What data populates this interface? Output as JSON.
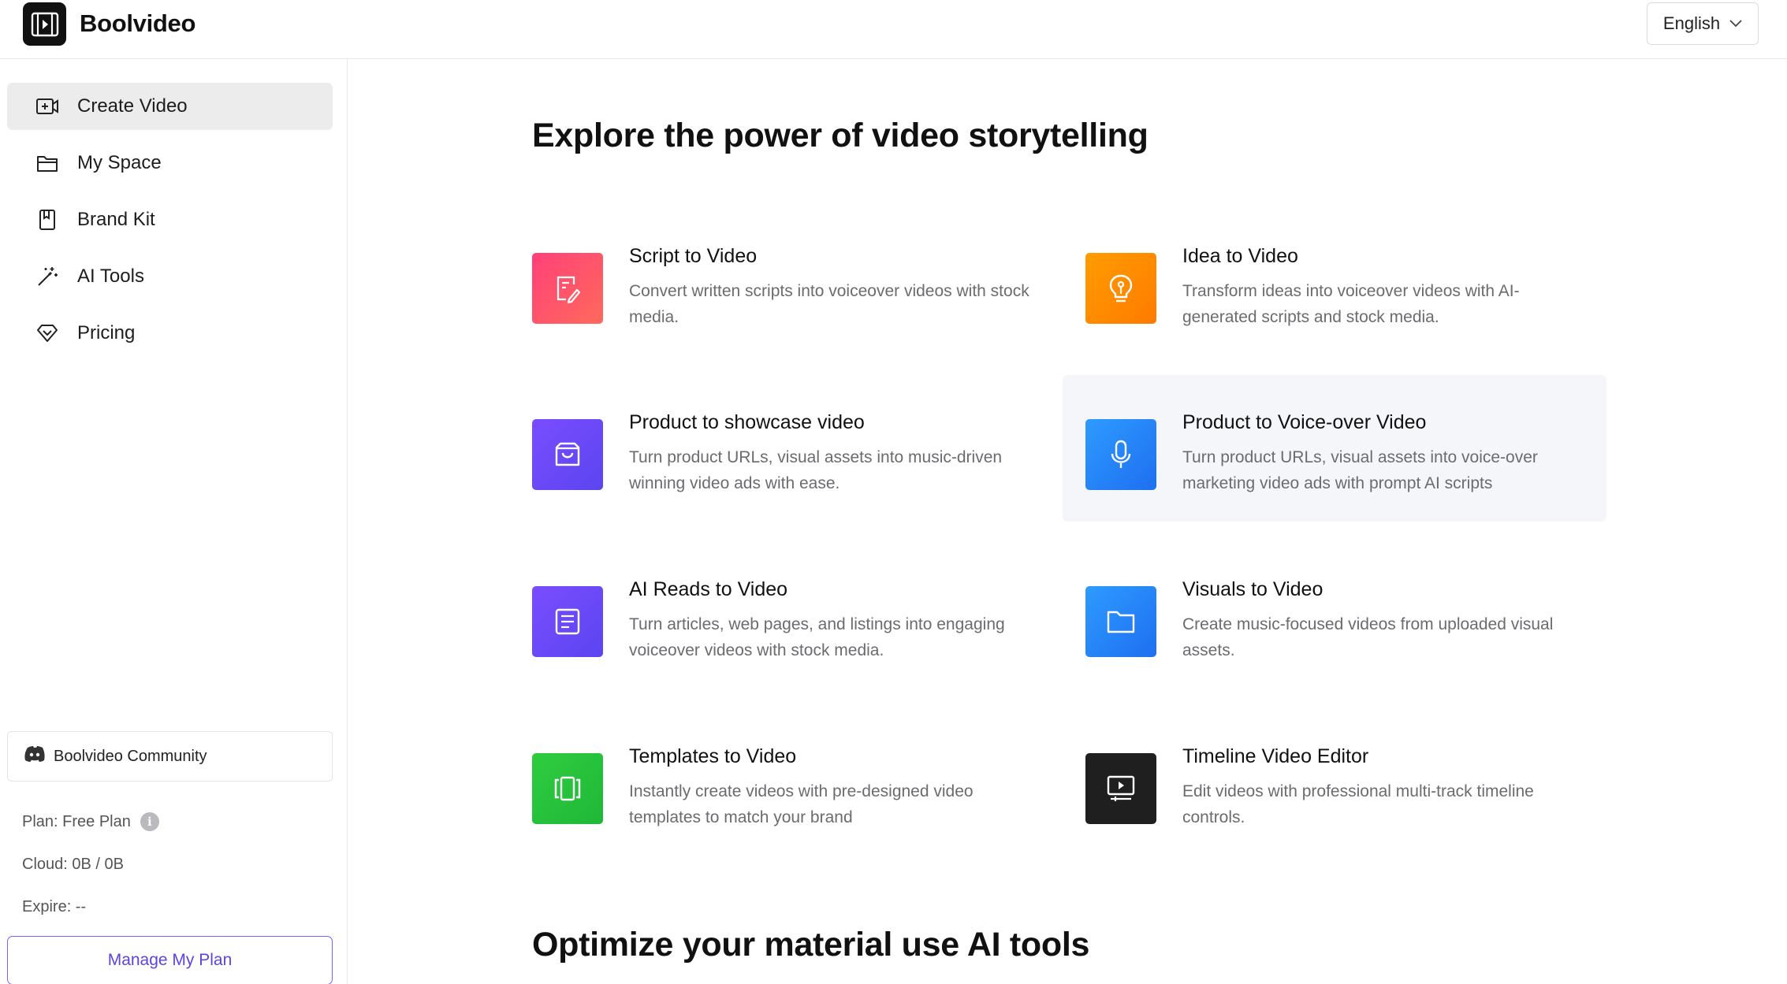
{
  "app": {
    "brand": "Boolvideo"
  },
  "header": {
    "language": "English"
  },
  "sidebar": {
    "items": [
      {
        "label": "Create Video",
        "icon": "video-plus-icon",
        "active": true
      },
      {
        "label": "My Space",
        "icon": "folder-icon",
        "active": false
      },
      {
        "label": "Brand Kit",
        "icon": "bookmark-icon",
        "active": false
      },
      {
        "label": "AI Tools",
        "icon": "magic-wand-icon",
        "active": false
      },
      {
        "label": "Pricing",
        "icon": "diamond-icon",
        "active": false
      }
    ],
    "community": "Boolvideo Community",
    "plan": "Plan: Free Plan",
    "cloud": "Cloud: 0B / 0B",
    "expire": "Expire: --",
    "manage_button": "Manage My Plan"
  },
  "main": {
    "title": "Explore the power of video storytelling",
    "section2_title": "Optimize your material use AI tools",
    "cards": [
      {
        "title": "Script to Video",
        "desc": "Convert written scripts into voiceover videos with stock media.",
        "icon": "script-edit-icon",
        "color": "#ff4f6e"
      },
      {
        "title": "Idea to Video",
        "desc": "Transform ideas into voiceover videos with AI-generated scripts and stock media.",
        "icon": "lightbulb-icon",
        "color": "#ff8a00"
      },
      {
        "title": "Product to showcase video",
        "desc": "Turn product URLs, visual assets into music-driven winning video ads with ease.",
        "icon": "shopping-bag-icon",
        "color": "#6e4cf5"
      },
      {
        "title": "Product to Voice-over Video",
        "desc": "Turn product URLs, visual assets into voice-over marketing video ads with prompt AI scripts",
        "icon": "microphone-icon",
        "color": "#1e88f5"
      },
      {
        "title": "AI Reads to Video",
        "desc": "Turn articles, web pages, and listings into engaging voiceover videos with stock media.",
        "icon": "article-icon",
        "color": "#6e4cf5"
      },
      {
        "title": "Visuals to Video",
        "desc": "Create music-focused videos from uploaded visual assets.",
        "icon": "folder-icon",
        "color": "#1e88f5"
      },
      {
        "title": "Templates to Video",
        "desc": "Instantly create videos with pre-designed video templates to match your brand",
        "icon": "templates-icon",
        "color": "#24c23c"
      },
      {
        "title": "Timeline Video Editor",
        "desc": "Edit videos with professional multi-track timeline controls.",
        "icon": "timeline-editor-icon",
        "color": "#1f1f1f"
      }
    ]
  }
}
